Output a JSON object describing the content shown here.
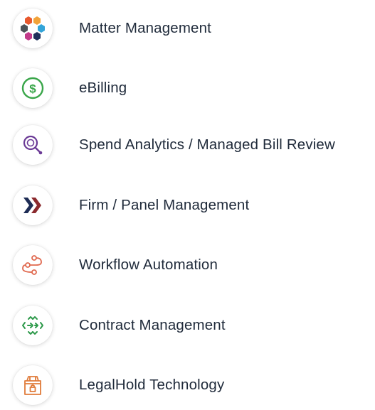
{
  "items": [
    {
      "label": "Matter Management",
      "icon": "hexagon-cluster-icon"
    },
    {
      "label": "eBilling",
      "icon": "dollar-circle-icon"
    },
    {
      "label": "Spend Analytics / Managed Bill Review",
      "icon": "magnifier-icon"
    },
    {
      "label": "Firm / Panel Management",
      "icon": "double-chevron-icon"
    },
    {
      "label": "Workflow Automation",
      "icon": "workflow-nodes-icon"
    },
    {
      "label": "Contract Management",
      "icon": "contract-arrows-icon"
    },
    {
      "label": "LegalHold Technology",
      "icon": "lockbox-icon"
    }
  ],
  "colors": {
    "text": "#1f2a3a",
    "ebilling": "#3aa64a",
    "analytics": "#6b3a96",
    "firm_dark": "#1e2c55",
    "firm_red": "#8b2a2e",
    "workflow": "#e0694f",
    "contract": "#2e9a4b",
    "legalhold": "#e07b3a"
  }
}
